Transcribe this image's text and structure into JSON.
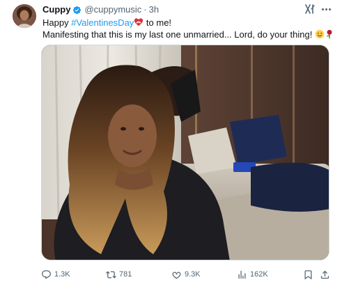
{
  "tweet": {
    "author": {
      "display_name": "Cuppy",
      "handle": "@cuppymusic",
      "separator": "·",
      "time": "3h"
    },
    "body": {
      "line1_prefix": "Happy ",
      "hashtag": "#ValentinesDay",
      "line1_suffix": " to me!",
      "line2": "Manifesting that this is my last one unmarried... Lord, do your thing! "
    },
    "stats": {
      "replies": "1.3K",
      "reposts": "781",
      "likes": "9.3K",
      "views": "162K"
    }
  },
  "colors": {
    "accent": "#1d9bf0",
    "text": "#0f1419",
    "secondary": "#536471",
    "border": "#cfd9de"
  },
  "icons": {
    "verified": "verified-badge-icon",
    "grok": "grok-icon",
    "more": "more-options-icon",
    "reply": "reply-icon",
    "repost": "repost-icon",
    "like": "heart-icon",
    "views": "views-chart-icon",
    "bookmark": "bookmark-icon",
    "share": "share-icon"
  }
}
